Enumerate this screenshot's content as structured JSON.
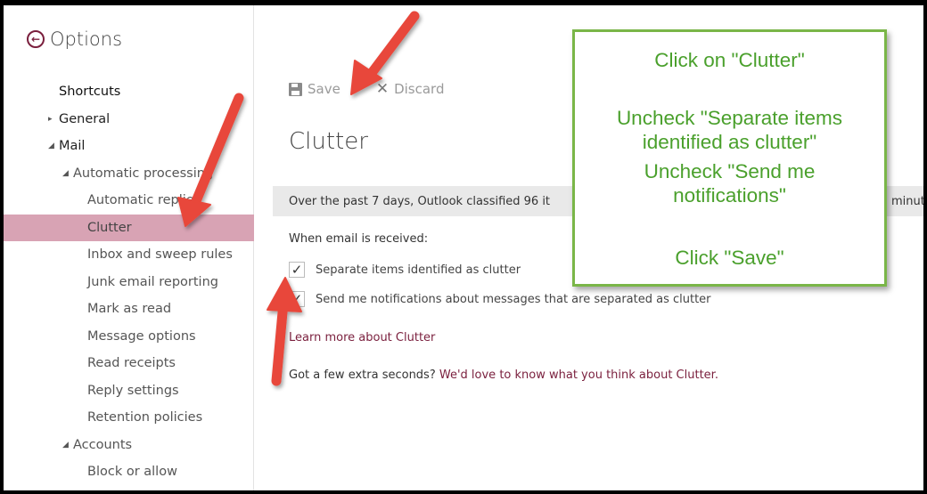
{
  "header": {
    "title": "Options",
    "back_icon": "back-arrow-circle-icon"
  },
  "sidebar": {
    "items": [
      {
        "label": "Shortcuts",
        "level": 0
      },
      {
        "label": "General",
        "level": 0,
        "toggle": "▸"
      },
      {
        "label": "Mail",
        "level": 0,
        "toggle": "◢"
      },
      {
        "label": "Automatic processing",
        "level": 1,
        "toggle": "◢"
      },
      {
        "label": "Automatic replies",
        "level": 2
      },
      {
        "label": "Clutter",
        "level": 2,
        "selected": true
      },
      {
        "label": "Inbox and sweep rules",
        "level": 2
      },
      {
        "label": "Junk email reporting",
        "level": 2
      },
      {
        "label": "Mark as read",
        "level": 2
      },
      {
        "label": "Message options",
        "level": 2
      },
      {
        "label": "Read receipts",
        "level": 2
      },
      {
        "label": "Reply settings",
        "level": 2
      },
      {
        "label": "Retention policies",
        "level": 2
      },
      {
        "label": "Accounts",
        "level": 1,
        "toggle": "◢"
      },
      {
        "label": "Block or allow",
        "level": 2
      }
    ],
    "selected_color": "#d8a3b4"
  },
  "toolbar": {
    "save_label": "Save",
    "discard_label": "Discard"
  },
  "main": {
    "title": "Clutter",
    "info_text": "Over the past 7 days, Outlook classified 96 it",
    "info_tail": "minutes",
    "when_label": "When email is received:",
    "checkbox1_label": "Separate items identified as clutter",
    "checkbox1_checked": true,
    "checkbox2_label": "Send me notifications about messages that are separated as clutter",
    "checkbox2_checked": true,
    "learn_more": "Learn more about Clutter",
    "feedback_prefix": "Got a few extra seconds? ",
    "feedback_link": "We'd love to know what you think about Clutter."
  },
  "callout": {
    "line1": "Click on \"Clutter\"",
    "line2a": "Uncheck \"Separate items",
    "line2b": "identified as clutter\"",
    "line3a": "Uncheck \"Send me",
    "line3b": "notifications\"",
    "line4": "Click \"Save\"",
    "border_color": "#7ab648",
    "text_color": "#4aa02c"
  },
  "colors": {
    "accent": "#7a1f3d",
    "arrow": "#e8473a"
  }
}
